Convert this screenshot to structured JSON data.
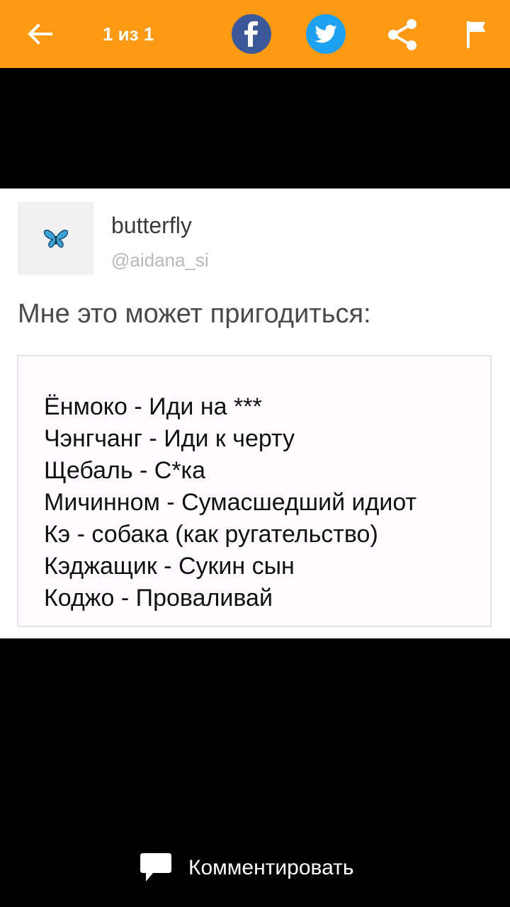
{
  "toolbar": {
    "counter": "1 из 1",
    "background_color": "#ff9a14",
    "icons": {
      "back": "arrow-left-icon",
      "facebook": "facebook-icon",
      "twitter": "twitter-icon",
      "share": "share-icon",
      "report": "flag-icon"
    },
    "facebook_color": "#3b5998",
    "twitter_color": "#1da1f2"
  },
  "post": {
    "display_name": "butterfly",
    "handle": "@aidana_si",
    "avatar_icon": "butterfly-icon",
    "text": "Мне это может пригодиться:",
    "quote_lines": [
      "Ёнмоко - Иди на ***",
      "Чэнгчанг - Иди к черту",
      "Щебаль - С*ка",
      "Мичинном - Сумасшедший идиот",
      "Кэ - собака (как ругательство)",
      "Кэджащик - Сукин сын",
      "Коджо - Проваливай"
    ]
  },
  "footer": {
    "comment_label": "Комментировать",
    "comment_icon": "speech-bubble-icon"
  }
}
